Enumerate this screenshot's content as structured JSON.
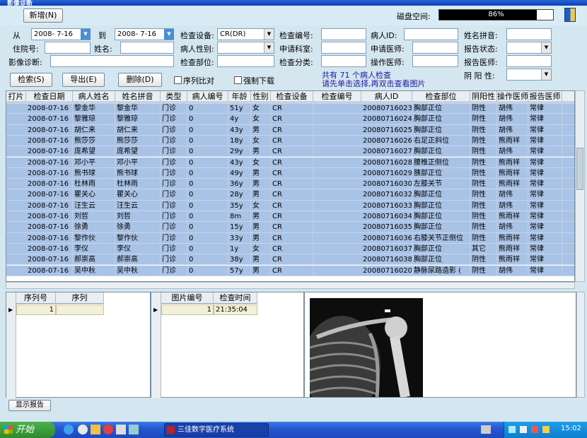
{
  "titlebar": {
    "title": "影像诊断"
  },
  "toolbar": {
    "new_label": "新增(N)",
    "disk_label": "磁盘空间:",
    "disk_percent": "86%",
    "disk_fraction": 0.86
  },
  "form": {
    "from_label": "从",
    "from_date": "2008- 7-16",
    "to_label": "到",
    "to_date": "2008- 7-16",
    "device_label": "检查设备:",
    "device_value": "CR(DR)",
    "exam_no_label": "检查编号:",
    "exam_no_value": "",
    "patient_id_label": "病人ID:",
    "patient_id_value": "",
    "pinyin_label": "姓名拼音:",
    "pinyin_value": "",
    "inpatient_label": "住院号:",
    "inpatient_value": "",
    "name_label": "姓名:",
    "name_value": "",
    "sex_label": "病人性别:",
    "sex_value": "",
    "dept_label": "申请科室:",
    "dept_value": "",
    "req_doctor_label": "申请医师:",
    "req_doctor_value": "",
    "report_status_label": "报告状态:",
    "report_status_value": "",
    "diagnosis_label": "影像诊断:",
    "diagnosis_value": "",
    "part_label": "检查部位:",
    "part_value": "",
    "category_label": "检查分类:",
    "category_value": "",
    "operator_label": "操作医师:",
    "operator_value": "",
    "report_doctor_label": "报告医师:",
    "report_doctor_value": "",
    "yinyang_label": "阴 阳 性:",
    "yinyang_value": ""
  },
  "actions": {
    "search_label": "检索(S)",
    "export_label": "导出(E)",
    "delete_label": "删除(D)",
    "seq_compare_label": "序列比对",
    "force_download_label": "强制下载"
  },
  "note": {
    "line1": "共有 71 个病人检查",
    "line2": "请先单击选择,再双击查看图片"
  },
  "grid": {
    "columns": [
      "打片",
      "检查日期",
      "病人姓名",
      "姓名拼音",
      "类型",
      "病人编号",
      "年龄",
      "性别",
      "检查设备",
      "检查编号",
      "病人ID",
      "检查部位",
      "阴阳性",
      "操作医师",
      "报告医师"
    ],
    "rows": [
      [
        "",
        "2008-07-16",
        "黎金华",
        "黎金华",
        "门诊",
        "0",
        "51y",
        "女",
        "CR",
        "",
        "20080716023",
        "胸部正位",
        "阴性",
        "胡伟",
        "常律"
      ],
      [
        "",
        "2008-07-16",
        "黎雅琼",
        "黎雅琼",
        "门诊",
        "0",
        "4y",
        "女",
        "CR",
        "",
        "20080716024",
        "胸部正位",
        "阴性",
        "胡伟",
        "常律"
      ],
      [
        "",
        "2008-07-16",
        "胡仁来",
        "胡仁来",
        "门诊",
        "0",
        "43y",
        "男",
        "CR",
        "",
        "20080716025",
        "胸部正位",
        "阴性",
        "胡伟",
        "常律"
      ],
      [
        "",
        "2008-07-16",
        "熊莎莎",
        "熊莎莎",
        "门诊",
        "0",
        "18y",
        "女",
        "CR",
        "",
        "20080716026",
        "右足正斜位",
        "阴性",
        "熊雨祥",
        "常律"
      ],
      [
        "",
        "2008-07-16",
        "庞希望",
        "庞希望",
        "门诊",
        "0",
        "29y",
        "男",
        "CR",
        "",
        "20080716027",
        "胸部正位",
        "阴性",
        "胡伟",
        "常律"
      ],
      [
        "",
        "2008-07-16",
        "邓小平",
        "邓小平",
        "门诊",
        "0",
        "43y",
        "女",
        "CR",
        "",
        "20080716028",
        "腰椎正侧位",
        "阴性",
        "熊雨祥",
        "常律"
      ],
      [
        "",
        "2008-07-16",
        "熊书球",
        "熊书球",
        "门诊",
        "0",
        "49y",
        "男",
        "CR",
        "",
        "20080716029",
        "胰部正位",
        "阴性",
        "熊雨祥",
        "常律"
      ],
      [
        "",
        "2008-07-16",
        "杜林雨",
        "杜林雨",
        "门诊",
        "0",
        "36y",
        "男",
        "CR",
        "",
        "20080716030",
        "左膝关节",
        "阴性",
        "熊雨祥",
        "常律"
      ],
      [
        "",
        "2008-07-16",
        "瞿关心",
        "瞿关心",
        "门诊",
        "0",
        "28y",
        "男",
        "CR",
        "",
        "20080716032",
        "胸部正位",
        "阴性",
        "胡伟",
        "常律"
      ],
      [
        "",
        "2008-07-16",
        "汪生云",
        "汪生云",
        "门诊",
        "0",
        "35y",
        "女",
        "CR",
        "",
        "20080716033",
        "胸部正位",
        "阴性",
        "胡伟",
        "常律"
      ],
      [
        "",
        "2008-07-16",
        "刘哲",
        "刘哲",
        "门诊",
        "0",
        "8m",
        "男",
        "CR",
        "",
        "20080716034",
        "胸部正位",
        "阴性",
        "熊雨祥",
        "常律"
      ],
      [
        "",
        "2008-07-16",
        "徐勇",
        "徐勇",
        "门诊",
        "0",
        "15y",
        "男",
        "CR",
        "",
        "20080716035",
        "胸部正位",
        "阴性",
        "胡伟",
        "常律"
      ],
      [
        "",
        "2008-07-16",
        "黎作伙",
        "黎作伙",
        "门诊",
        "0",
        "33y",
        "男",
        "CR",
        "",
        "20080716036",
        "右膝关节正侧位",
        "阴性",
        "熊雨祥",
        "常律"
      ],
      [
        "",
        "2008-07-16",
        "李仪",
        "李仪",
        "门诊",
        "0",
        "1y",
        "女",
        "CR",
        "",
        "20080716037",
        "胸部正位",
        "其它",
        "熊雨祥",
        "常律"
      ],
      [
        "",
        "2008-07-16",
        "郝崇高",
        "郝崇高",
        "门诊",
        "0",
        "38y",
        "男",
        "CR",
        "",
        "20080716038",
        "胸部正位",
        "阴性",
        "熊雨祥",
        "常律"
      ],
      [
        "",
        "2008-07-16",
        "吴中秋",
        "吴中秋",
        "门诊",
        "0",
        "57y",
        "男",
        "CR",
        "",
        "20080716020",
        "静脉尿路造影 (",
        "阴性",
        "胡伟",
        "常律"
      ]
    ]
  },
  "seq_panel": {
    "col1": "序列号",
    "col2": "序列",
    "row_seq": "1",
    "row_series": ""
  },
  "img_panel": {
    "col1": "图片编号",
    "col2": "检查时间",
    "row_no": "1",
    "row_time": "21:35:04"
  },
  "report_button": {
    "label": "显示报告"
  },
  "taskbar": {
    "start_label": "开始",
    "task_label": "三佳数字医疗系统",
    "clock": "15:02"
  }
}
